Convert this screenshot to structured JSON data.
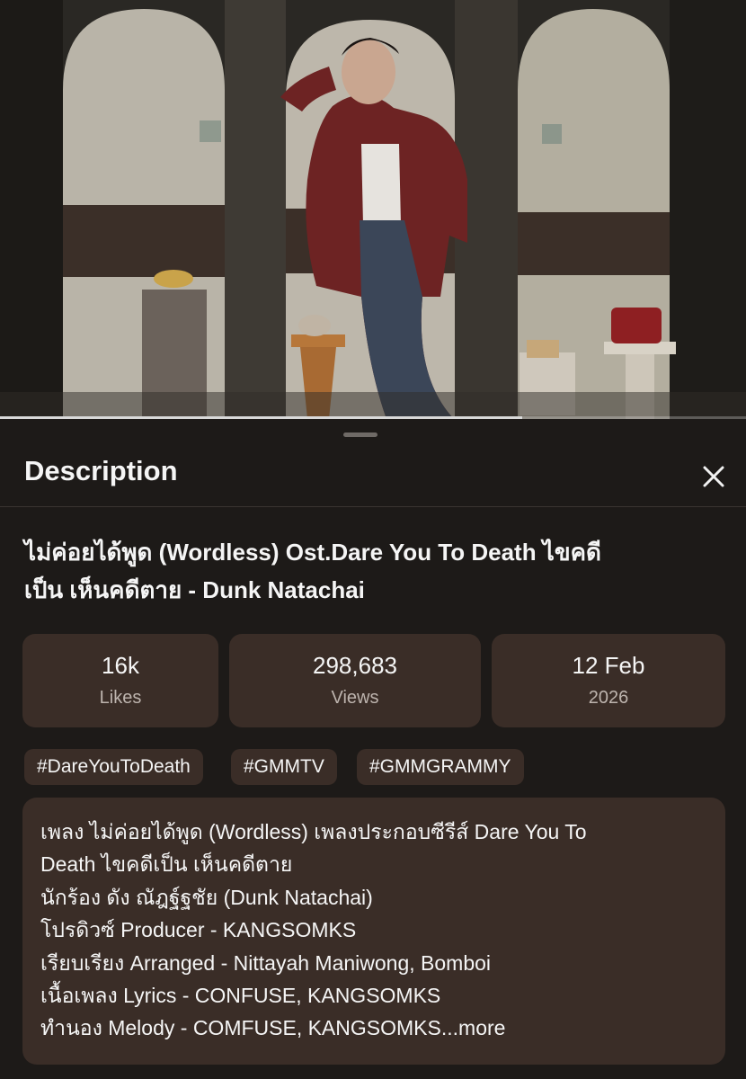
{
  "video": {
    "progress_fraction": 0.7
  },
  "description_sheet": {
    "title": "Description",
    "close_icon": "close-icon",
    "video_title_line1": "ไม่ค่อยได้พูด (Wordless) Ost.Dare You To Death ไขคดี",
    "video_title_line2": "เป็น เห็นคดีตาย - Dunk Natachai",
    "stats": [
      {
        "value": "16k",
        "label": "Likes"
      },
      {
        "value": "298,683",
        "label": "Views"
      },
      {
        "value": "12 Feb",
        "label": "2026"
      }
    ],
    "hashtags": [
      "#DareYouToDeath",
      "#GMMTV",
      "#GMMGRAMMY"
    ],
    "description_lines": [
      "เพลง ไม่ค่อยได้พูด (Wordless) เพลงประกอบซีรีส์ Dare You To",
      "Death ไขคดีเป็น เห็นคดีตาย",
      "นักร้อง ดัง ณัฎฐ์ฐชัย (Dunk Natachai)",
      "โปรดิวซ์ Producer - KANGSOMKS",
      "เรียบเรียง Arranged -  Nittayah Maniwong, Bomboi",
      "เนื้อเพลง Lyrics - CONFUSE, KANGSOMKS",
      "ทำนอง Melody - COMFUSE, KANGSOMKS"
    ],
    "more_label": "...more"
  }
}
